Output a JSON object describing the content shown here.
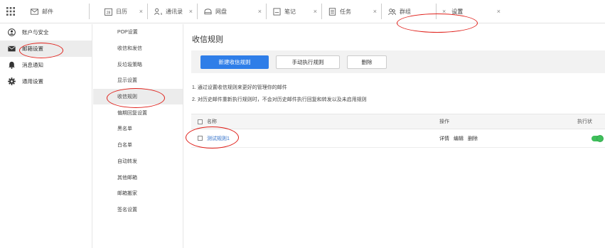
{
  "tabs": [
    {
      "id": "mail",
      "label": "邮件",
      "icon": "mail-icon",
      "closable": false,
      "active": false
    },
    {
      "id": "calendar",
      "label": "日历",
      "icon": "calendar-icon",
      "icon_text": "28",
      "closable": true,
      "active": false
    },
    {
      "id": "contacts",
      "label": "通讯录",
      "icon": "contacts-icon",
      "closable": true,
      "active": false
    },
    {
      "id": "drive",
      "label": "网盘",
      "icon": "cloud-icon",
      "closable": true,
      "active": false
    },
    {
      "id": "notes",
      "label": "笔记",
      "icon": "notes-icon",
      "closable": true,
      "active": false
    },
    {
      "id": "tasks",
      "label": "任务",
      "icon": "tasks-icon",
      "closable": true,
      "active": false
    },
    {
      "id": "groups",
      "label": "群组",
      "icon": "group-icon",
      "closable": true,
      "active": false
    },
    {
      "id": "settings",
      "label": "设置",
      "icon": "settings-icon",
      "closable": true,
      "active": true
    }
  ],
  "left_nav": [
    {
      "label": "账户与安全",
      "icon": "user-circle-icon",
      "active": false
    },
    {
      "label": "邮箱设置",
      "icon": "envelope-icon",
      "active": true
    },
    {
      "label": "消息通知",
      "icon": "bell-icon",
      "active": false
    },
    {
      "label": "通用设置",
      "icon": "gear-icon",
      "active": false
    }
  ],
  "sub_nav": [
    {
      "label": "POP设置",
      "active": false
    },
    {
      "label": "收信和发信",
      "active": false
    },
    {
      "label": "反垃圾策略",
      "active": false
    },
    {
      "label": "显示设置",
      "active": false
    },
    {
      "label": "收信规则",
      "active": true
    },
    {
      "label": "偏期回复设置",
      "active": false
    },
    {
      "label": "黑名单",
      "active": false
    },
    {
      "label": "白名单",
      "active": false
    },
    {
      "label": "自动转发",
      "active": false
    },
    {
      "label": "其他邮箱",
      "active": false
    },
    {
      "label": "邮箱搬家",
      "active": false
    },
    {
      "label": "签名设置",
      "active": false
    }
  ],
  "main": {
    "title": "收信规则",
    "buttons": {
      "new_rule": "新建收信规则",
      "run_rule": "手动执行规则",
      "delete": "删除"
    },
    "tips": [
      "1. 通过设置收信规则来更好的管理你的邮件",
      "2. 对历史邮件重新执行规则时，不会对历史邮件执行回复和转发以及未启用规则"
    ],
    "table": {
      "headers": {
        "name": "名称",
        "ops": "操作",
        "exec": "执行状"
      },
      "rows": [
        {
          "name": "测试规则1",
          "ops": [
            "详情",
            "编辑",
            "删除"
          ],
          "enabled": true
        }
      ]
    }
  },
  "colors": {
    "accent": "#2f7ee8",
    "toggle_on": "#3fbf5b",
    "annotation": "#e0201a",
    "link": "#2f6fc8"
  }
}
